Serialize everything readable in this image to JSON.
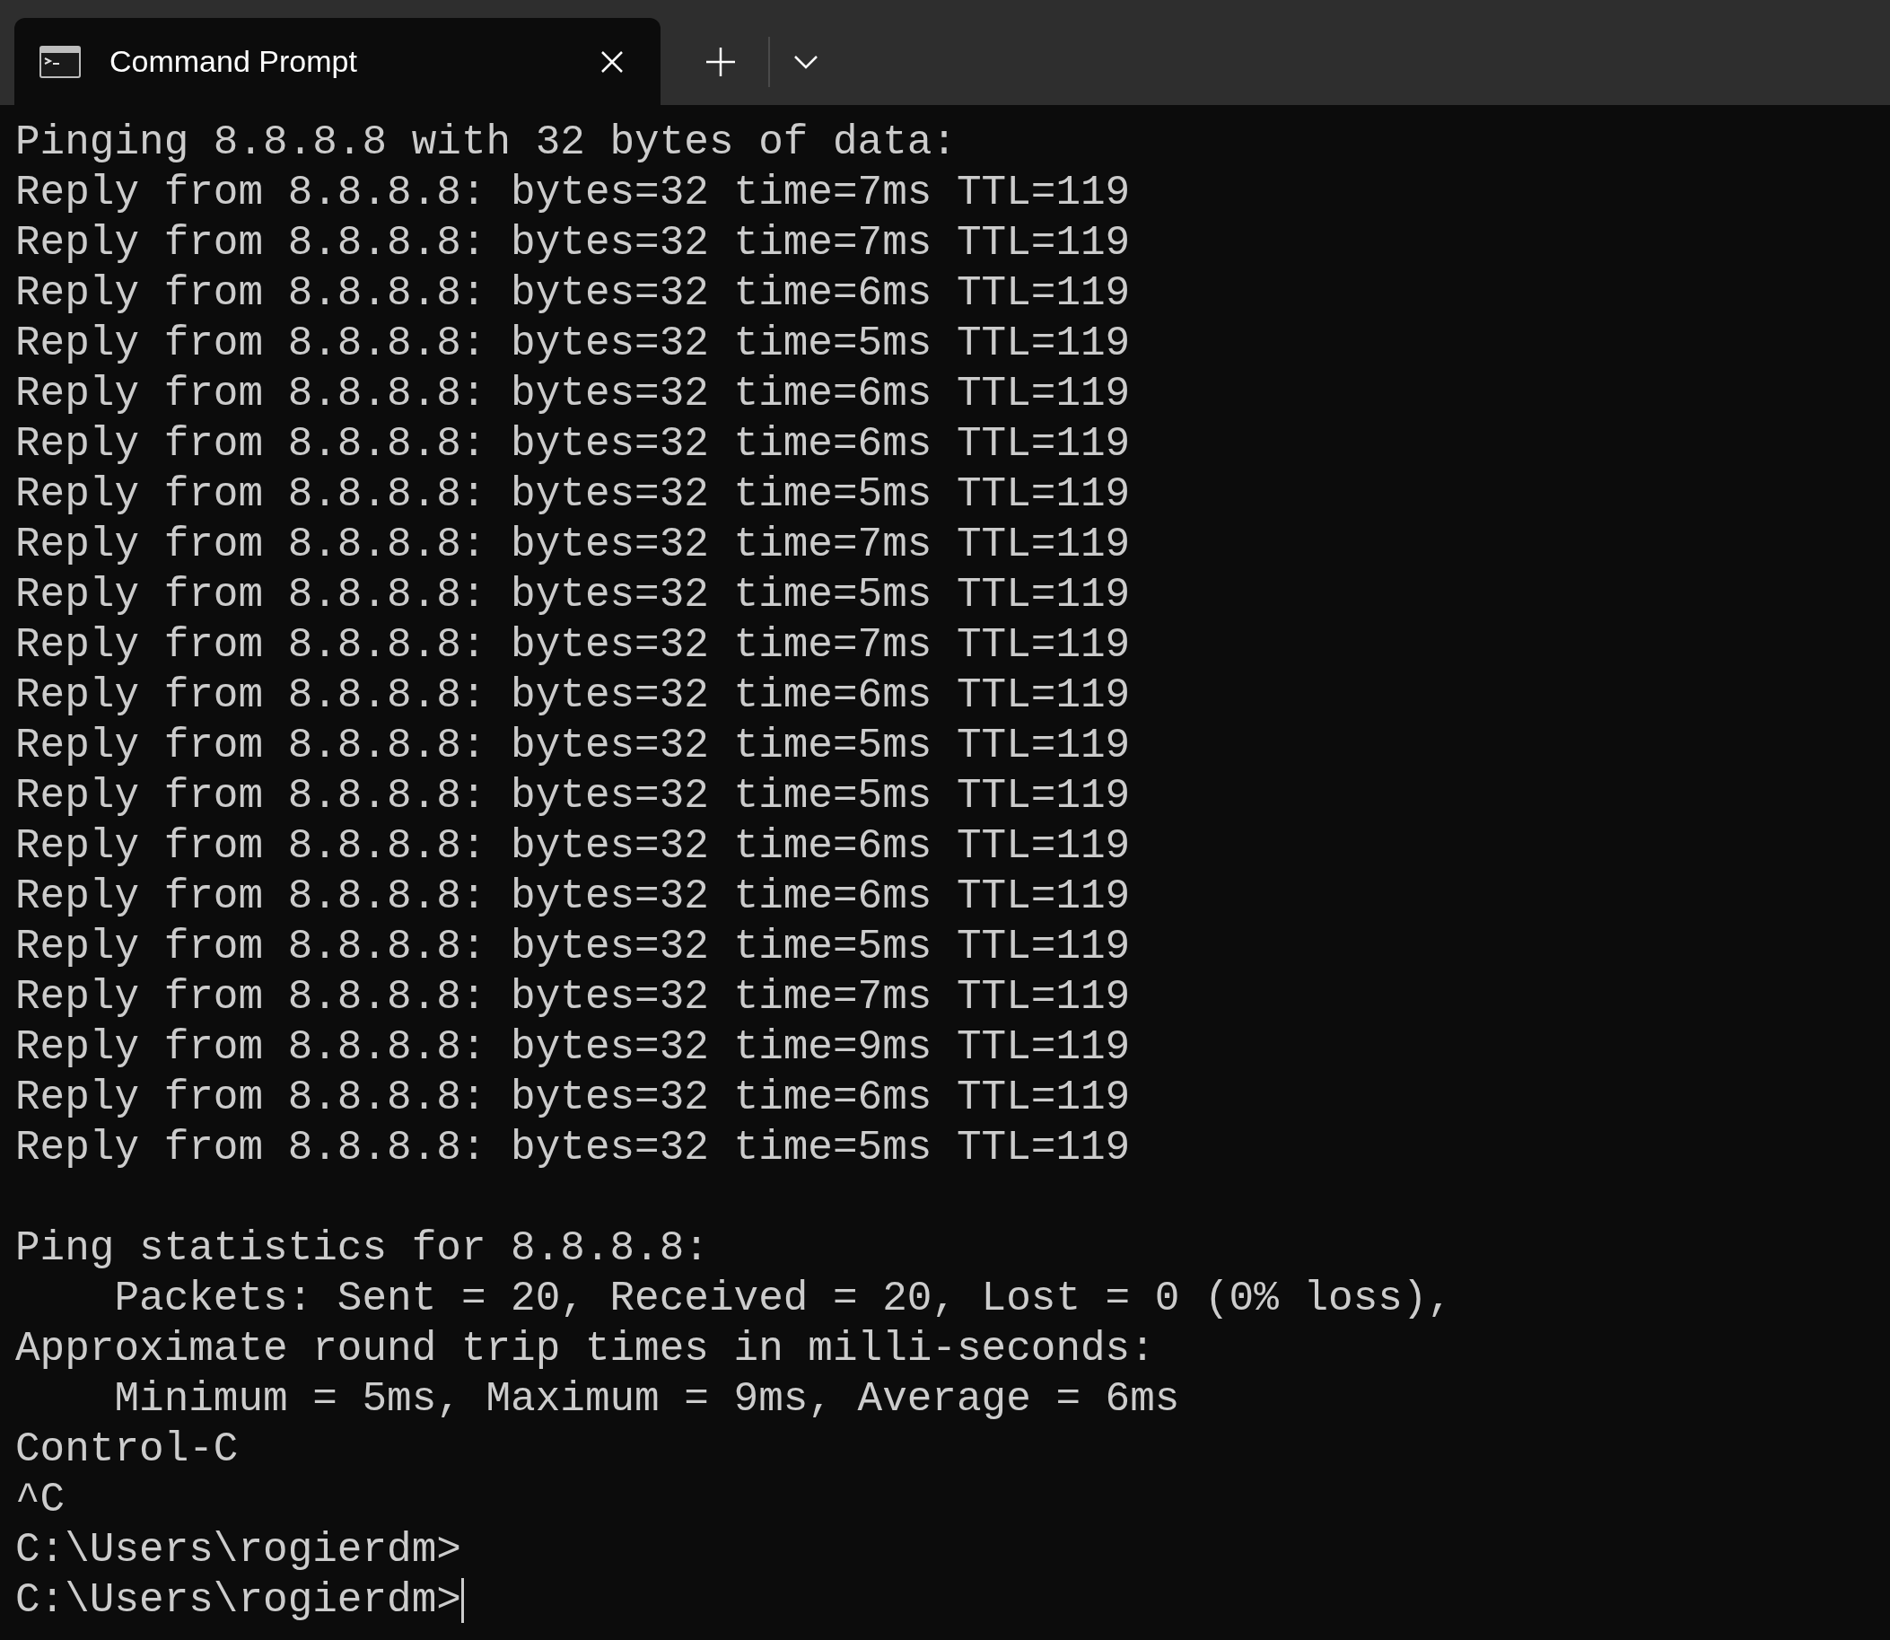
{
  "tab": {
    "title": "Command Prompt"
  },
  "blocks": [
    {
      "lines": [
        "Pinging 8.8.8.8 with 32 bytes of data:",
        "Reply from 8.8.8.8: bytes=32 time=7ms TTL=119",
        "Reply from 8.8.8.8: bytes=32 time=7ms TTL=119",
        "Reply from 8.8.8.8: bytes=32 time=6ms TTL=119",
        "Reply from 8.8.8.8: bytes=32 time=5ms TTL=119",
        "Reply from 8.8.8.8: bytes=32 time=6ms TTL=119",
        "Reply from 8.8.8.8: bytes=32 time=6ms TTL=119",
        "Reply from 8.8.8.8: bytes=32 time=5ms TTL=119",
        "Reply from 8.8.8.8: bytes=32 time=7ms TTL=119",
        "Reply from 8.8.8.8: bytes=32 time=5ms TTL=119",
        "Reply from 8.8.8.8: bytes=32 time=7ms TTL=119",
        "Reply from 8.8.8.8: bytes=32 time=6ms TTL=119",
        "Reply from 8.8.8.8: bytes=32 time=5ms TTL=119",
        "Reply from 8.8.8.8: bytes=32 time=5ms TTL=119",
        "Reply from 8.8.8.8: bytes=32 time=6ms TTL=119",
        "Reply from 8.8.8.8: bytes=32 time=6ms TTL=119",
        "Reply from 8.8.8.8: bytes=32 time=5ms TTL=119",
        "Reply from 8.8.8.8: bytes=32 time=7ms TTL=119",
        "Reply from 8.8.8.8: bytes=32 time=9ms TTL=119",
        "Reply from 8.8.8.8: bytes=32 time=6ms TTL=119",
        "Reply from 8.8.8.8: bytes=32 time=5ms TTL=119"
      ]
    },
    {
      "lines": [
        "Ping statistics for 8.8.8.8:",
        "    Packets: Sent = 20, Received = 20, Lost = 0 (0% loss),",
        "Approximate round trip times in milli-seconds:",
        "    Minimum = 5ms, Maximum = 9ms, Average = 6ms",
        "Control-C",
        "^C",
        "C:\\Users\\rogierdm>",
        "C:\\Users\\rogierdm>"
      ]
    }
  ]
}
